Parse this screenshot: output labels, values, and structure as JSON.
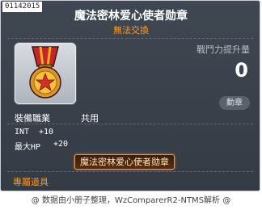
{
  "item": {
    "id": "01142015",
    "name": "魔法密林爱心使者勋章",
    "trade_status": "無法交換",
    "icon": "medal-icon",
    "power_label": "戰鬥力提升量",
    "power_value": "0",
    "category": "勳章",
    "job_label": "裝備職業",
    "job_value": "共用",
    "stats": [
      {
        "name": "INT",
        "value": "+10"
      },
      {
        "name": "最大HP",
        "value": "+20"
      }
    ],
    "set_plate": "魔法密林爱心使者勋章",
    "unique_label": "專屬道具"
  },
  "credit": "@ 数据由小册子整理，WzComparerR2-NTMS解析 @",
  "colors": {
    "panel": "#3a414b",
    "accent_orange": "#ff9a1f",
    "text": "#ffffff"
  }
}
